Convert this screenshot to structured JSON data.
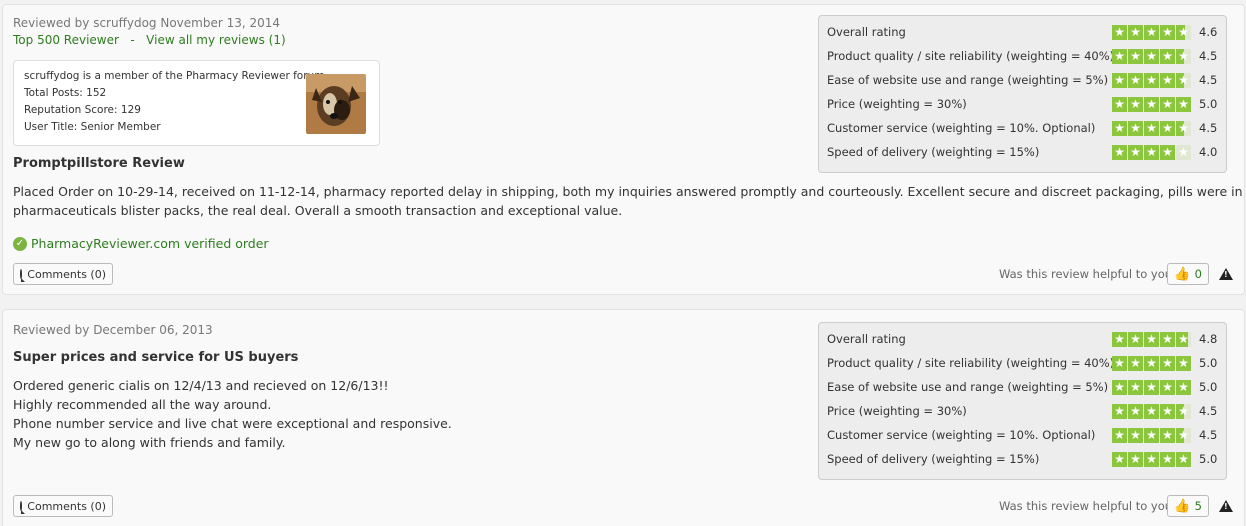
{
  "reviews": [
    {
      "reviewed_by_prefix": "Reviewed by",
      "reviewer": "scruffydog",
      "date": "November 13, 2014",
      "top_reviewer": "Top 500 Reviewer",
      "separator": "-",
      "view_all": "View all my reviews (1)",
      "forum": {
        "member": "scruffydog",
        "member_suffix": "is a member of the Pharmacy Reviewer forum",
        "total_posts": "Total Posts: 152",
        "reputation": "Reputation Score: 129",
        "user_title": "User Title: Senior Member"
      },
      "title": "Promptpillstore Review",
      "body": [
        "Placed Order on 10-29-14, received on 11-12-14, pharmacy reported delay in shipping, both my inquiries answered promptly and courteously. Excellent secure and discreet packaging, pills were in vipro",
        "pharmaceuticals blister packs, the real deal. Overall a smooth transaction and exceptional value."
      ],
      "verified": "PharmacyReviewer.com verified order",
      "comments": "Comments (0)",
      "helpful_q": "Was this review helpful to you?",
      "helpful_count": "0",
      "ratings": [
        {
          "label": "Overall rating",
          "value": "4.6",
          "stars": 4.6
        },
        {
          "label": "Product quality / site reliability (weighting = 40%)",
          "value": "4.5",
          "stars": 4.5
        },
        {
          "label": "Ease of website use and range (weighting = 5%)",
          "value": "4.5",
          "stars": 4.5
        },
        {
          "label": "Price (weighting = 30%)",
          "value": "5.0",
          "stars": 5.0
        },
        {
          "label": "Customer service (weighting = 10%. Optional)",
          "value": "4.5",
          "stars": 4.5
        },
        {
          "label": "Speed of delivery (weighting = 15%)",
          "value": "4.0",
          "stars": 4.0
        }
      ]
    },
    {
      "reviewed_by_prefix": "Reviewed by",
      "date": "December 06, 2013",
      "title": "Super prices and service for US buyers",
      "body": [
        "Ordered generic cialis on 12/4/13 and recieved on 12/6/13!!",
        "Highly recommended all the way around.",
        "Phone number service and live chat were exceptional and responsive.",
        "My new go to along with friends and family."
      ],
      "comments": "Comments (0)",
      "helpful_q": "Was this review helpful to you?",
      "helpful_count": "5",
      "ratings": [
        {
          "label": "Overall rating",
          "value": "4.8",
          "stars": 4.8
        },
        {
          "label": "Product quality / site reliability (weighting = 40%)",
          "value": "5.0",
          "stars": 5.0
        },
        {
          "label": "Ease of website use and range (weighting = 5%)",
          "value": "5.0",
          "stars": 5.0
        },
        {
          "label": "Price (weighting = 30%)",
          "value": "4.5",
          "stars": 4.5
        },
        {
          "label": "Customer service (weighting = 10%. Optional)",
          "value": "4.5",
          "stars": 4.5
        },
        {
          "label": "Speed of delivery (weighting = 15%)",
          "value": "5.0",
          "stars": 5.0
        }
      ]
    }
  ],
  "icons": {
    "comments": "speech-bubble-icon",
    "helpful": "thumbs-up-icon",
    "report": "warning-triangle-icon",
    "verified": "leaf-check-icon"
  },
  "colors": {
    "star_green": "#8cc63f",
    "link_green": "#2e7d1e"
  }
}
